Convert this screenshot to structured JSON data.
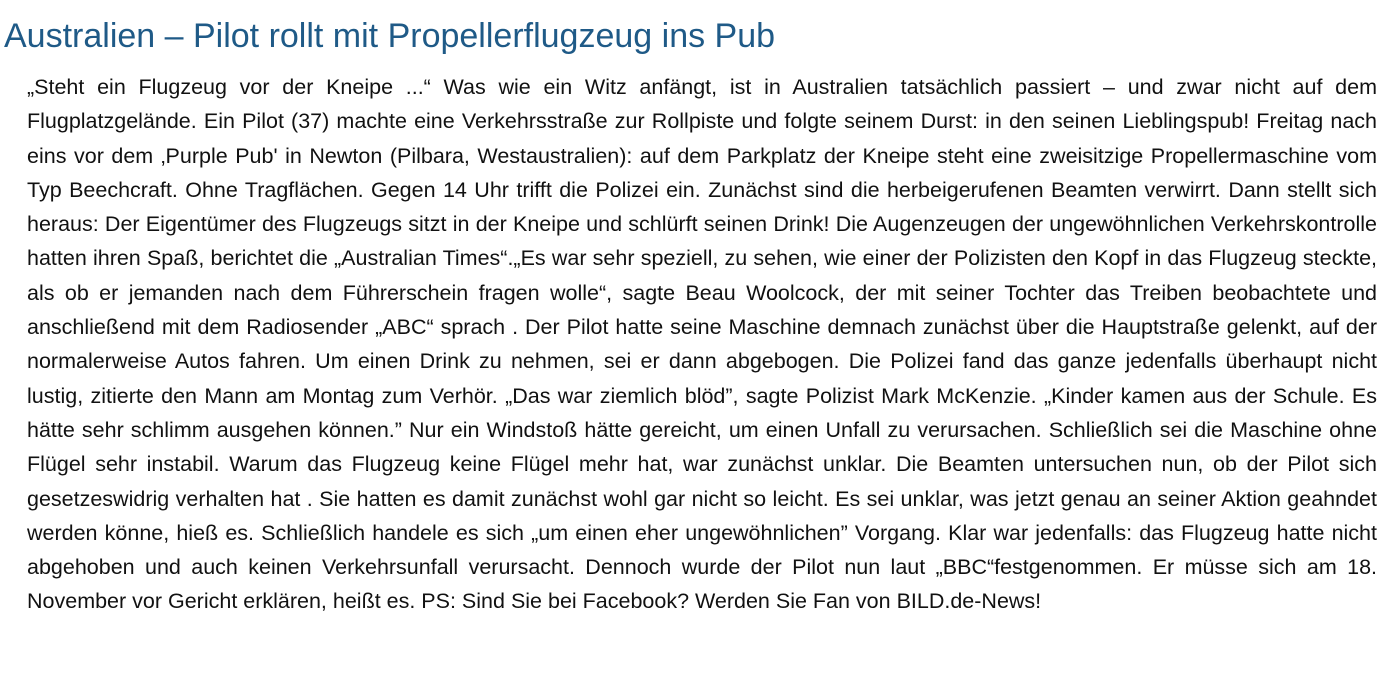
{
  "article": {
    "title": "Australien – Pilot rollt mit Propellerflugzeug ins Pub",
    "body": "„Steht ein Flugzeug vor der Kneipe ...“ Was wie ein Witz anfängt, ist in Australien tatsächlich passiert – und zwar nicht auf dem Flugplatzgelände. Ein Pilot (37) machte eine Verkehrsstraße zur Rollpiste und folgte seinem Durst: in den seinen Lieblingspub! Freitag nach eins vor dem ‚Purple Pub' in Newton (Pilbara, Westaustralien): auf dem Parkplatz der Kneipe steht eine zweisitzige Propellermaschine vom Typ Beechcraft. Ohne Tragflächen. Gegen 14 Uhr trifft die Polizei ein. Zunächst sind die herbeigerufenen Beamten verwirrt. Dann stellt sich heraus: Der Eigentümer des Flugzeugs sitzt in der Kneipe und schlürft seinen Drink! Die Augenzeugen der ungewöhnlichen Verkehrskontrolle hatten ihren Spaß, berichtet die „Australian Times“.„Es war sehr speziell, zu sehen, wie einer der Polizisten den Kopf in das Flugzeug steckte, als ob er jemanden nach dem Führerschein fragen wolle“, sagte Beau Woolcock, der mit seiner Tochter das Treiben beobachtete und anschließend mit dem Radiosender „ABC“ sprach . Der Pilot hatte seine Maschine demnach zunächst über die Hauptstraße gelenkt, auf der normalerweise Autos fahren. Um einen Drink zu nehmen, sei er dann abgebogen. Die Polizei fand das ganze jedenfalls überhaupt nicht lustig, zitierte den Mann am Montag zum Verhör. „Das war ziemlich blöd”, sagte Polizist Mark McKenzie. „Kinder kamen aus der Schule. Es hätte sehr schlimm ausgehen können.” Nur ein Windstoß hätte gereicht, um einen Unfall zu verursachen. Schließlich sei die Maschine ohne Flügel sehr instabil. Warum das Flugzeug keine Flügel mehr hat, war zunächst unklar. Die Beamten untersuchen nun, ob der Pilot sich gesetzeswidrig verhalten hat . Sie hatten es damit zunächst wohl gar nicht so leicht. Es sei unklar, was jetzt genau an seiner Aktion geahndet werden könne, hieß es. Schließlich handele es sich „um einen eher ungewöhnlichen” Vorgang. Klar war jedenfalls: das Flugzeug hatte nicht abgehoben und auch keinen Verkehrsunfall verursacht. Dennoch wurde der Pilot nun laut „BBC“festgenommen. Er müsse sich am 18. November vor Gericht erklären, heißt es. PS: Sind Sie bei Facebook? Werden Sie Fan von BILD.de-News!"
  },
  "colors": {
    "title": "#1f5a87",
    "body_text": "#111111",
    "background": "#ffffff"
  }
}
